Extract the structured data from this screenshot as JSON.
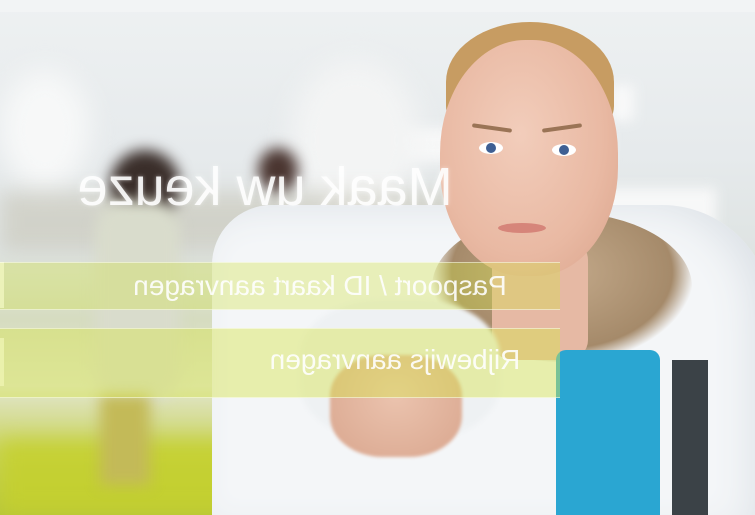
{
  "screen": {
    "title": "Maak uw keuze",
    "options": [
      {
        "label": "Paspoort / ID kaart aanvragen"
      },
      {
        "label": "Rijbewijs aanvragen"
      }
    ]
  },
  "colors": {
    "accent": "#d2e146",
    "text": "#ffffff",
    "shirt": "#2aa6d2"
  }
}
